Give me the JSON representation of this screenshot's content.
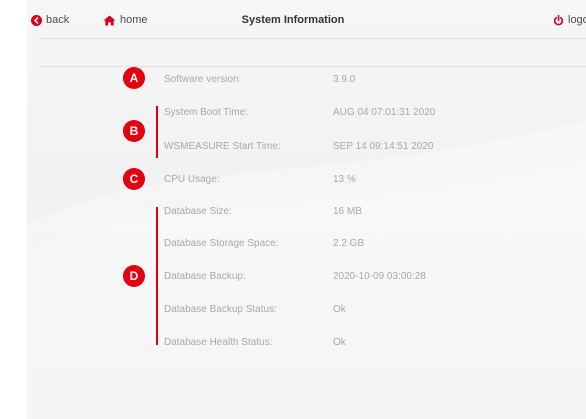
{
  "header": {
    "back_label": "back",
    "home_label": "home",
    "title": "System Information",
    "logout_label": "logo"
  },
  "markers": [
    "A",
    "B",
    "C",
    "D"
  ],
  "info": [
    {
      "label": "Software version:",
      "value": "3.9.0"
    },
    {
      "label": "System Boot Time:",
      "value": "AUG 04 07:01:31 2020"
    },
    {
      "label": "WSMEASURE Start Time:",
      "value": "SEP 14 09:14:51 2020"
    },
    {
      "label": "CPU Usage:",
      "value": "13 %"
    },
    {
      "label": "Database Size:",
      "value": "16 MB"
    },
    {
      "label": "Database Storage Space:",
      "value": "2.2 GB"
    },
    {
      "label": "Database Backup:",
      "value": "2020-10-09 03:00:28"
    },
    {
      "label": "Database Backup Status:",
      "value": "Ok"
    },
    {
      "label": "Database Health Status:",
      "value": "Ok"
    }
  ],
  "colors": {
    "accent": "#e3000f",
    "text_muted": "#a9a7a7"
  }
}
